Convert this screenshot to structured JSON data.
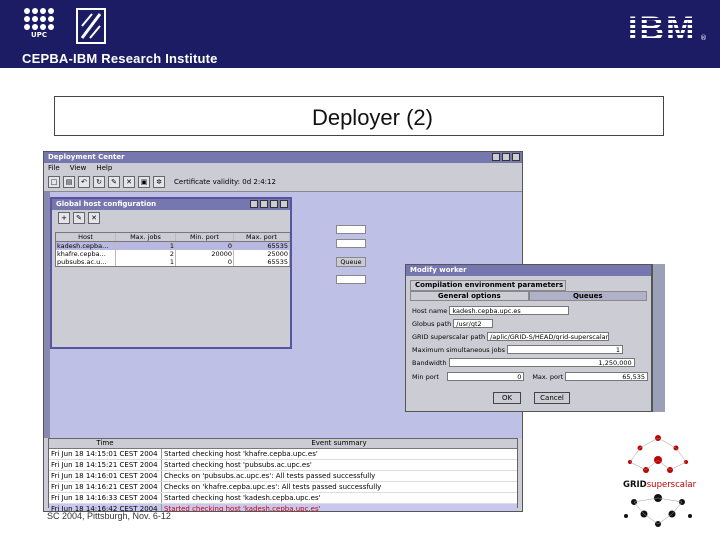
{
  "header": {
    "upc_logo_text": "UPC",
    "ibm_logo": "IBM",
    "ibm_registered": "®",
    "institute": "CEPBA-IBM Research Institute",
    "colors": {
      "bar": "#1c1c64",
      "text": "#ffffff"
    }
  },
  "slide": {
    "title": "Deployer (2)",
    "footer": "SC 2004, Pittsburgh, Nov. 6-12"
  },
  "deployment_center": {
    "title": "Deployment Center",
    "menu": [
      "File",
      "View",
      "Help"
    ],
    "toolbar_icons": [
      "new-icon",
      "open-icon",
      "save-icon",
      "refresh-icon",
      "edit-icon",
      "remove-icon",
      "monitor-icon",
      "settings-icon"
    ],
    "certificate": "Certificate validity: 0d 2:4:12",
    "side_label": "Queue",
    "events": {
      "columns": [
        "Time",
        "Event summary"
      ],
      "rows": [
        {
          "time": "Fri Jun 18 14:15:01 CEST 2004",
          "summary": "Started checking host 'khafre.cepba.upc.es'"
        },
        {
          "time": "Fri Jun 18 14:15:21 CEST 2004",
          "summary": "Started checking host 'pubsubs.ac.upc.es'"
        },
        {
          "time": "Fri Jun 18 14:16:01 CEST 2004",
          "summary": "Checks on 'pubsubs.ac.upc.es': All tests passed successfully"
        },
        {
          "time": "Fri Jun 18 14:16:21 CEST 2004",
          "summary": "Checks on 'khafre.cepba.upc.es': All tests passed successfully"
        },
        {
          "time": "Fri Jun 18 14:16:33 CEST 2004",
          "summary": "Started checking host 'kadesh.cepba.upc.es'"
        },
        {
          "time": "Fri Jun 18 14:16:42 CEST 2004",
          "summary": "Started checking host 'kadesh.cepba.upc.es'"
        }
      ]
    }
  },
  "global_host_config": {
    "title": "Global host configuration",
    "toolbar_icons": [
      "add-host-icon",
      "edit-host-icon",
      "remove-host-icon"
    ],
    "columns": [
      "Host",
      "Max. jobs",
      "Min. port",
      "Max. port"
    ],
    "rows": [
      {
        "host": "kadesh.cepba...",
        "max_jobs": "1",
        "min_port": "0",
        "max_port": "65535"
      },
      {
        "host": "khafre.cepba...",
        "max_jobs": "2",
        "min_port": "20000",
        "max_port": "25000"
      },
      {
        "host": "pubsubs.ac.u...",
        "max_jobs": "1",
        "min_port": "0",
        "max_port": "65535"
      }
    ]
  },
  "modify_worker": {
    "title": "Modify worker",
    "tab_main": "Compilation environment parameters",
    "tabs": [
      "General options",
      "Queues"
    ],
    "fields": {
      "host_name": {
        "label": "Host name",
        "value": "kadesh.cepba.upc.es"
      },
      "globus_path": {
        "label": "Globus path",
        "value": "/usr/gt2"
      },
      "grid_path": {
        "label": "GRID superscalar path",
        "value": "/aplic/GRID-S/HEAD/grid-superscalar-1.6.0"
      },
      "max_jobs": {
        "label": "Maximum simultaneous jobs",
        "value": "1"
      },
      "bandwidth": {
        "label": "Bandwidth",
        "value": "1,250,000"
      },
      "min_port": {
        "label": "Min port",
        "value": "0"
      },
      "max_port": {
        "label": "Max. port",
        "value": "65,535"
      }
    },
    "ok": "OK",
    "cancel": "Cancel"
  },
  "grid_logo": {
    "word1": "GRID",
    "word2": "superscalar",
    "colors": {
      "dark": "#111111",
      "red": "#c00000"
    }
  }
}
